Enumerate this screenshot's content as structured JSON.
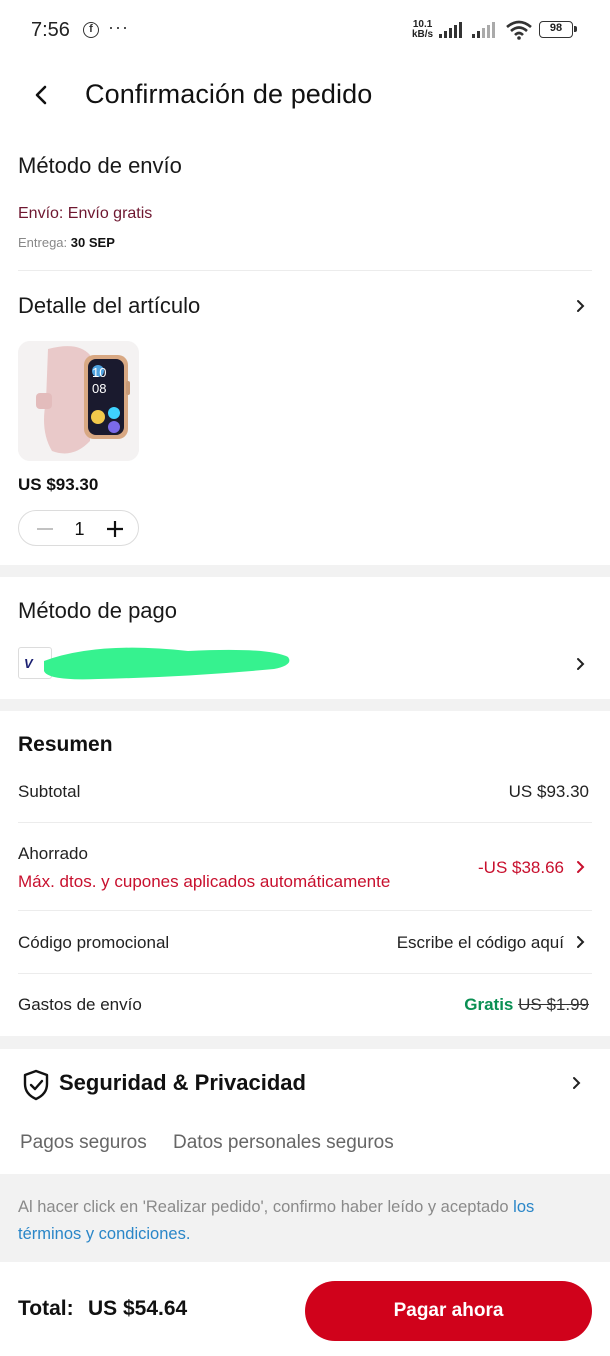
{
  "status_bar": {
    "time": "7:56",
    "notification_icons": [
      "facebook-icon",
      "more-dots-icon"
    ],
    "net_speed_value": "10.1",
    "net_speed_unit": "kB/s",
    "battery": "98"
  },
  "header": {
    "title": "Confirmación de pedido",
    "back_icon": "chevron-left-icon"
  },
  "shipping": {
    "section_title": "Método de envío",
    "method": "Envío: Envío gratis",
    "delivery_label": "Entrega:",
    "delivery_date": "30 SEP"
  },
  "item_detail": {
    "section_title": "Detalle del artículo",
    "price": "US $93.30",
    "quantity": "1"
  },
  "payment": {
    "section_title": "Método de pago",
    "card_logo": "V"
  },
  "summary": {
    "title": "Resumen",
    "subtotal_label": "Subtotal",
    "subtotal_value": "US $93.30",
    "saved_label": "Ahorrado",
    "saved_note": "Máx. dtos. y cupones aplicados automáticamente",
    "saved_value": "-US $38.66",
    "promo_label": "Código promocional",
    "promo_placeholder": "Escribe el código aquí",
    "shipping_label": "Gastos de envío",
    "shipping_free": "Gratis",
    "shipping_original": "US $1.99"
  },
  "security": {
    "title": "Seguridad & Privacidad",
    "item_1": "Pagos seguros",
    "item_2": "Datos personales seguros"
  },
  "terms": {
    "text": "Al hacer click en 'Realizar pedido', confirmo haber leído y aceptado ",
    "link": "los términos y condiciones."
  },
  "footer": {
    "total_label": "Total:",
    "total_value": "US $54.64",
    "pay_button": "Pagar ahora"
  },
  "colors": {
    "brand_red": "#d0021b",
    "discount_red": "#c8102e",
    "free_green": "#0a8f53",
    "link_blue": "#2a86c8"
  }
}
